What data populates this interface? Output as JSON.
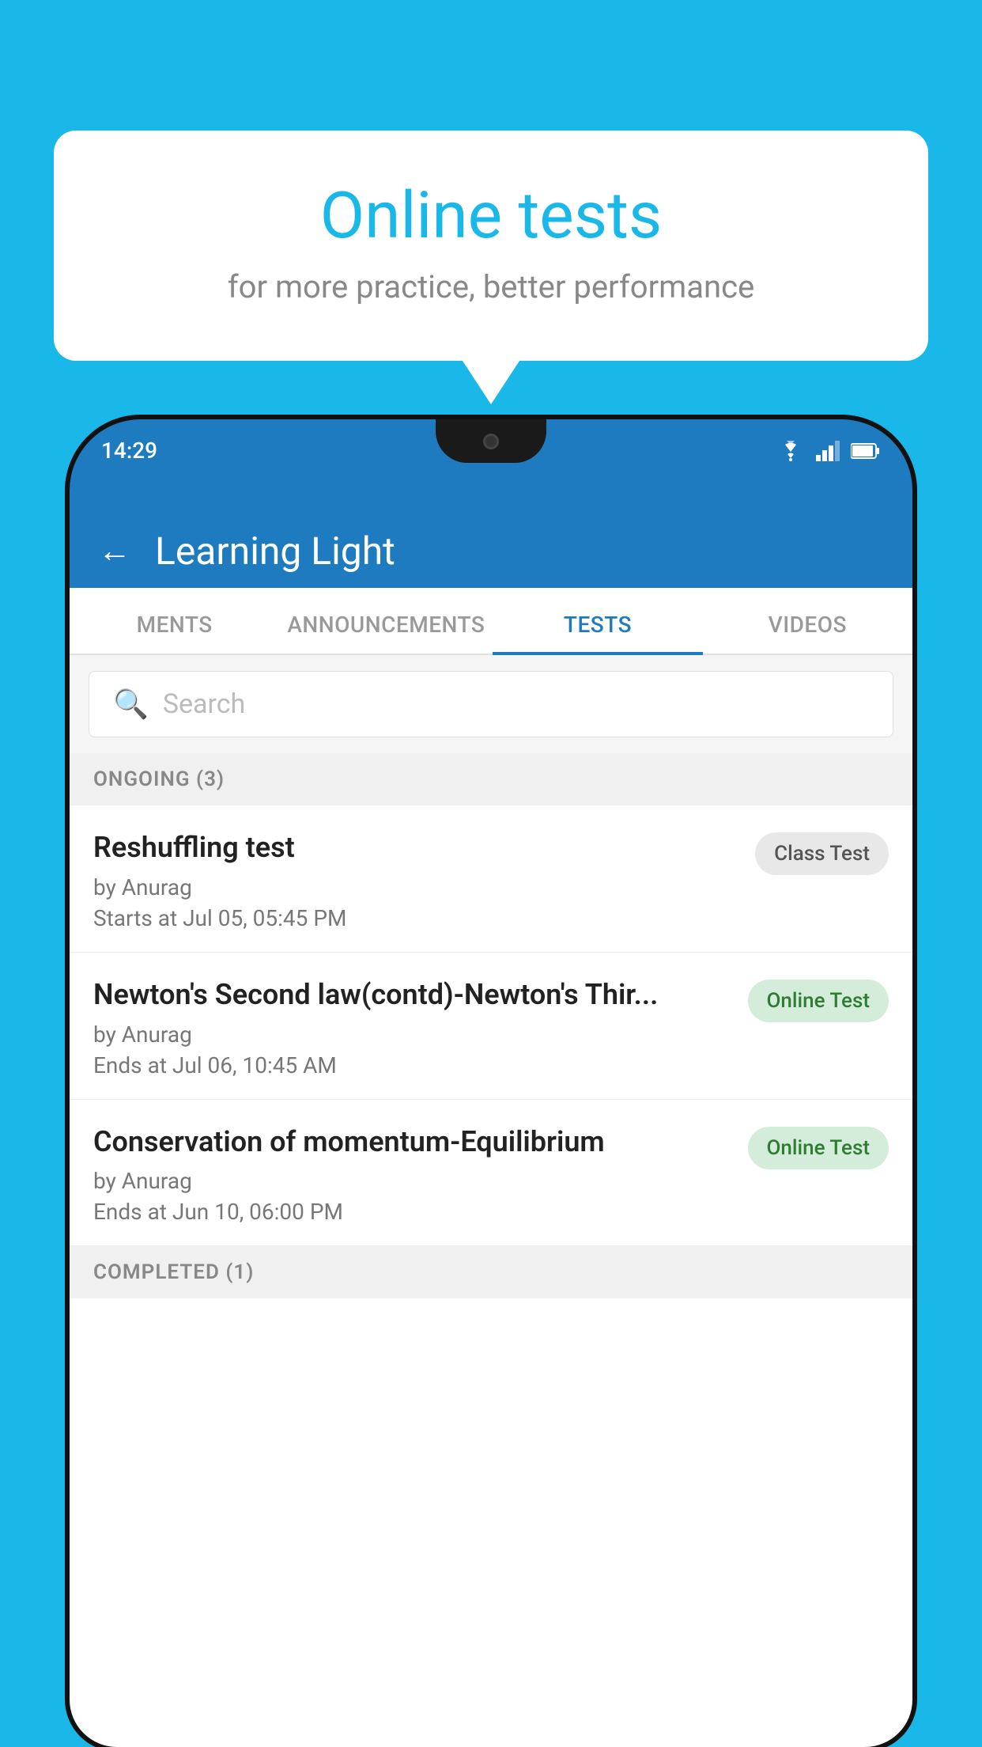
{
  "background_color": "#1ab8e8",
  "bubble": {
    "title": "Online tests",
    "subtitle": "for more practice, better performance"
  },
  "phone": {
    "status_bar": {
      "time": "14:29",
      "icons": [
        "wifi",
        "signal",
        "battery"
      ]
    },
    "header": {
      "title": "Learning Light",
      "back_label": "←"
    },
    "tabs": [
      {
        "label": "MENTS",
        "active": false
      },
      {
        "label": "ANNOUNCEMENTS",
        "active": false
      },
      {
        "label": "TESTS",
        "active": true
      },
      {
        "label": "VIDEOS",
        "active": false
      }
    ],
    "search": {
      "placeholder": "Search"
    },
    "ongoing_section": {
      "label": "ONGOING (3)"
    },
    "tests": [
      {
        "name": "Reshuffling test",
        "by": "by Anurag",
        "time_label": "Starts at",
        "time": "Jul 05, 05:45 PM",
        "badge": "Class Test",
        "badge_type": "class"
      },
      {
        "name": "Newton's Second law(contd)-Newton's Thir...",
        "by": "by Anurag",
        "time_label": "Ends at",
        "time": "Jul 06, 10:45 AM",
        "badge": "Online Test",
        "badge_type": "online"
      },
      {
        "name": "Conservation of momentum-Equilibrium",
        "by": "by Anurag",
        "time_label": "Ends at",
        "time": "Jun 10, 06:00 PM",
        "badge": "Online Test",
        "badge_type": "online"
      }
    ],
    "completed_section": {
      "label": "COMPLETED (1)"
    }
  }
}
